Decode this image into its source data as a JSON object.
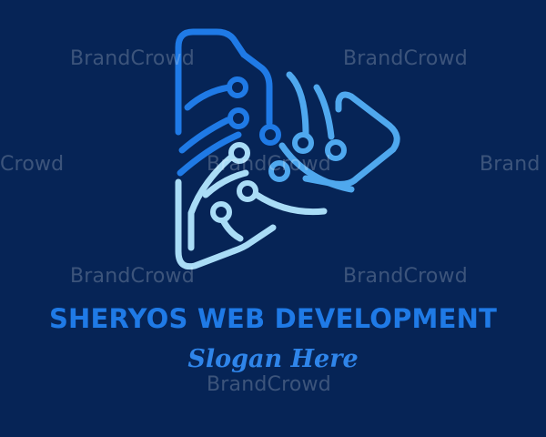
{
  "brand": {
    "name": "SHERYOS WEB DEVELOPMENT",
    "slogan": "Slogan Here"
  },
  "watermark": {
    "text": "BrandCrowd",
    "partial_left": "Crowd",
    "partial_right": "Brand"
  },
  "colors": {
    "background": "#062456",
    "logo_dark_blue": "#1f7ae6",
    "logo_mid_blue": "#4fa8ee",
    "logo_light_blue": "#a9dcf6",
    "text_blue": "#1f7ae6"
  },
  "logo": {
    "icon": "circuit-play-triangle-icon"
  }
}
